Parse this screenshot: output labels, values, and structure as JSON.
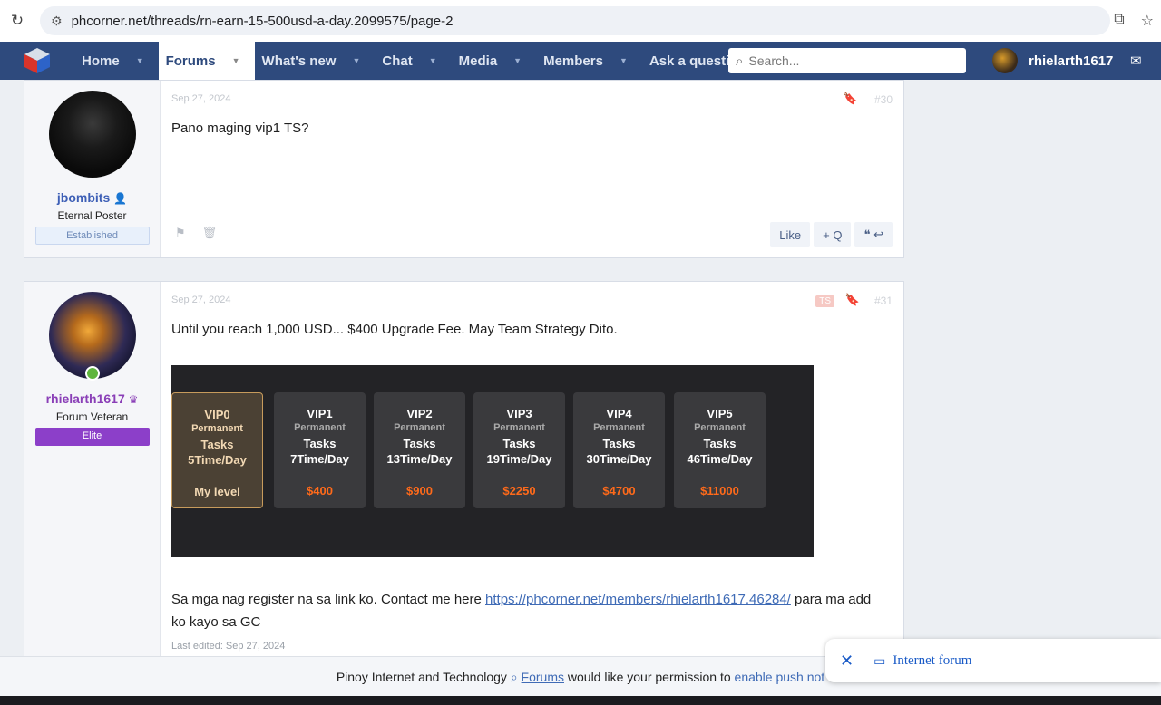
{
  "browser": {
    "url": "phcorner.net/threads/rn-earn-15-500usd-a-day.2099575/page-2"
  },
  "nav": {
    "items": [
      {
        "label": "Home",
        "active": false
      },
      {
        "label": "Forums",
        "active": true
      },
      {
        "label": "What's new",
        "active": false
      },
      {
        "label": "Chat",
        "active": false
      },
      {
        "label": "Media",
        "active": false
      },
      {
        "label": "Members",
        "active": false
      },
      {
        "label": "Ask a question",
        "active": false
      }
    ],
    "search_placeholder": "Search...",
    "username": "rhielarth1617"
  },
  "posts": [
    {
      "author": "jbombits",
      "user_title": "Eternal Poster",
      "banner": "Established",
      "date": "Sep 27, 2024",
      "number": "#30",
      "text": "Pano maging vip1 TS?",
      "actions": {
        "like": "Like",
        "quote": "+ Q"
      }
    },
    {
      "author": "rhielarth1617",
      "user_title": "Forum Veteran",
      "banner": "Elite",
      "date": "Sep 27, 2024",
      "number": "#31",
      "ts_badge": "TS",
      "text": "Until you reach 1,000 USD... $400 Upgrade Fee. May Team Strategy Dito.",
      "vip_levels": [
        {
          "name": "VIP0",
          "perm": "Permanent",
          "tasks": "Tasks",
          "per_day": "5Time/Day",
          "price": "My level"
        },
        {
          "name": "VIP1",
          "perm": "Permanent",
          "tasks": "Tasks",
          "per_day": "7Time/Day",
          "price": "$400"
        },
        {
          "name": "VIP2",
          "perm": "Permanent",
          "tasks": "Tasks",
          "per_day": "13Time/Day",
          "price": "$900"
        },
        {
          "name": "VIP3",
          "perm": "Permanent",
          "tasks": "Tasks",
          "per_day": "19Time/Day",
          "price": "$2250"
        },
        {
          "name": "VIP4",
          "perm": "Permanent",
          "tasks": "Tasks",
          "per_day": "30Time/Day",
          "price": "$4700"
        },
        {
          "name": "VIP5",
          "perm": "Permanent",
          "tasks": "Tasks",
          "per_day": "46Time/Day",
          "price": "$11000"
        }
      ],
      "text2_before": "Sa mga nag register na sa link ko. Contact me here ",
      "text2_link": "https://phcorner.net/members/rhielarth1617.46284/",
      "text2_after": " para ma add ko kayo sa GC",
      "last_edited": "Last edited: Sep 27, 2024"
    }
  ],
  "notification": {
    "prefix": "Pinoy Internet and Technology ",
    "forums": "Forums",
    "middle": " would like your permission to ",
    "enable": "enable push not"
  },
  "popup": {
    "label": "Internet forum"
  }
}
